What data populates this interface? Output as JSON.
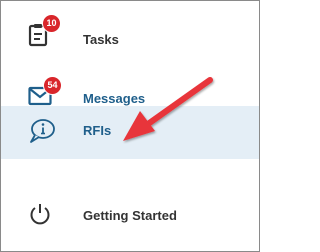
{
  "nav": {
    "items": [
      {
        "key": "tasks",
        "label": "Tasks",
        "icon": "clipboard-icon",
        "badge": "10"
      },
      {
        "key": "messages",
        "label": "Messages",
        "icon": "envelope-icon",
        "badge": "54"
      },
      {
        "key": "rfis",
        "label": "RFIs",
        "icon": "info-speech-bubble-icon",
        "selected": true
      },
      {
        "key": "getting_started",
        "label": "Getting Started",
        "icon": "power-icon"
      }
    ]
  },
  "colors": {
    "badge": "#d9262b",
    "accent_text": "#1f5f8b",
    "selected_row": "#e4eef6",
    "annotation_arrow": "#e8343a",
    "icon": "#333333"
  }
}
